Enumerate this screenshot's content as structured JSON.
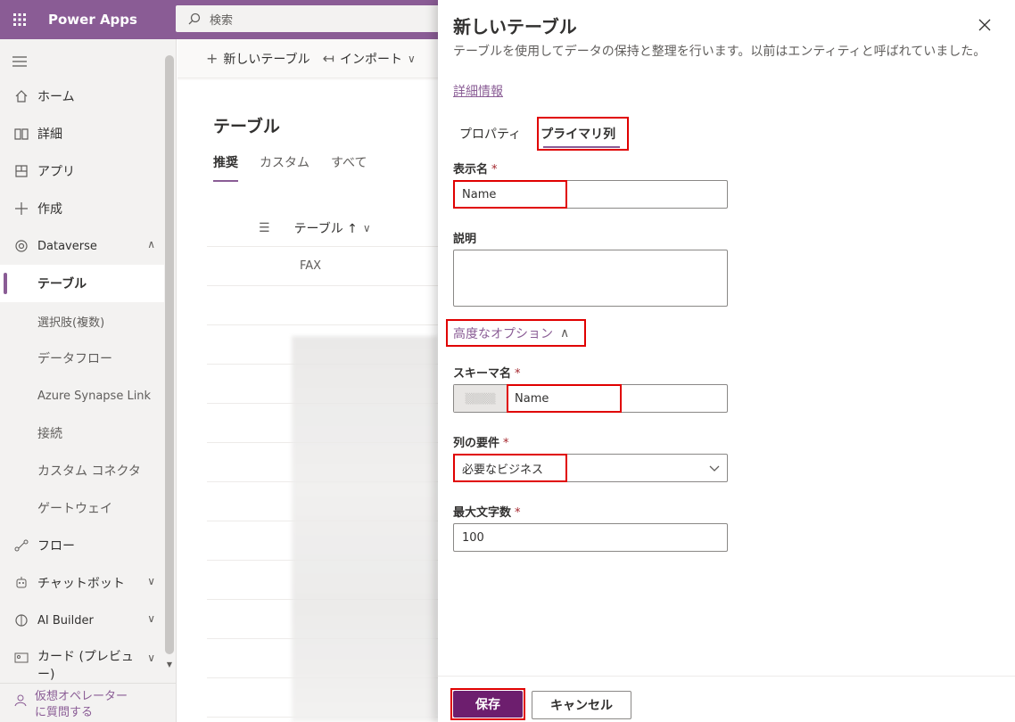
{
  "app": {
    "name": "Power Apps"
  },
  "search": {
    "placeholder": "検索"
  },
  "nav": {
    "items": [
      {
        "label": "ホーム",
        "icon": "home-icon"
      },
      {
        "label": "詳細",
        "icon": "book-icon"
      },
      {
        "label": "アプリ",
        "icon": "apps-icon"
      },
      {
        "label": "作成",
        "icon": "plus-icon"
      },
      {
        "label": "Dataverse",
        "icon": "dataverse-icon"
      },
      {
        "label": "テーブル"
      },
      {
        "label": "選択肢(複数)"
      },
      {
        "label": "データフロー"
      },
      {
        "label": "Azure Synapse Link"
      },
      {
        "label": "接続"
      },
      {
        "label": "カスタム コネクタ"
      },
      {
        "label": "ゲートウェイ"
      },
      {
        "label": "フロー",
        "icon": "flow-icon"
      },
      {
        "label": "チャットボット",
        "icon": "bot-icon"
      },
      {
        "label": "AI Builder",
        "icon": "ai-icon"
      },
      {
        "label": "カード (プレビュー)",
        "icon": "card-icon"
      }
    ],
    "bottom": "仮想オペレーター\nに質問する"
  },
  "cmdbar": {
    "new_table": "新しいテーブル",
    "import": "インポート"
  },
  "main": {
    "title": "テーブル",
    "pivots": [
      "推奨",
      "カスタム",
      "すべて"
    ],
    "column": "テーブル ↑",
    "row1": "FAX"
  },
  "panel": {
    "title": "新しいテーブル",
    "description": "テーブルを使用してデータの保持と整理を行います。以前はエンティティと呼ばれていました。",
    "learn_more": "詳細情報",
    "tabs": [
      "プロパティ",
      "プライマリ列"
    ],
    "display_name_label": "表示名",
    "display_name_value": "Name",
    "description_label": "説明",
    "advanced_options": "高度なオプション",
    "schema_label": "スキーマ名",
    "schema_value": "Name",
    "requirement_label": "列の要件",
    "requirement_value": "必要なビジネス",
    "max_chars_label": "最大文字数",
    "max_chars_value": "100",
    "save": "保存",
    "cancel": "キャンセル"
  },
  "colors": {
    "brand": "#8a5c95",
    "primary_button": "#6d1e6e",
    "highlight": "#e00000"
  }
}
